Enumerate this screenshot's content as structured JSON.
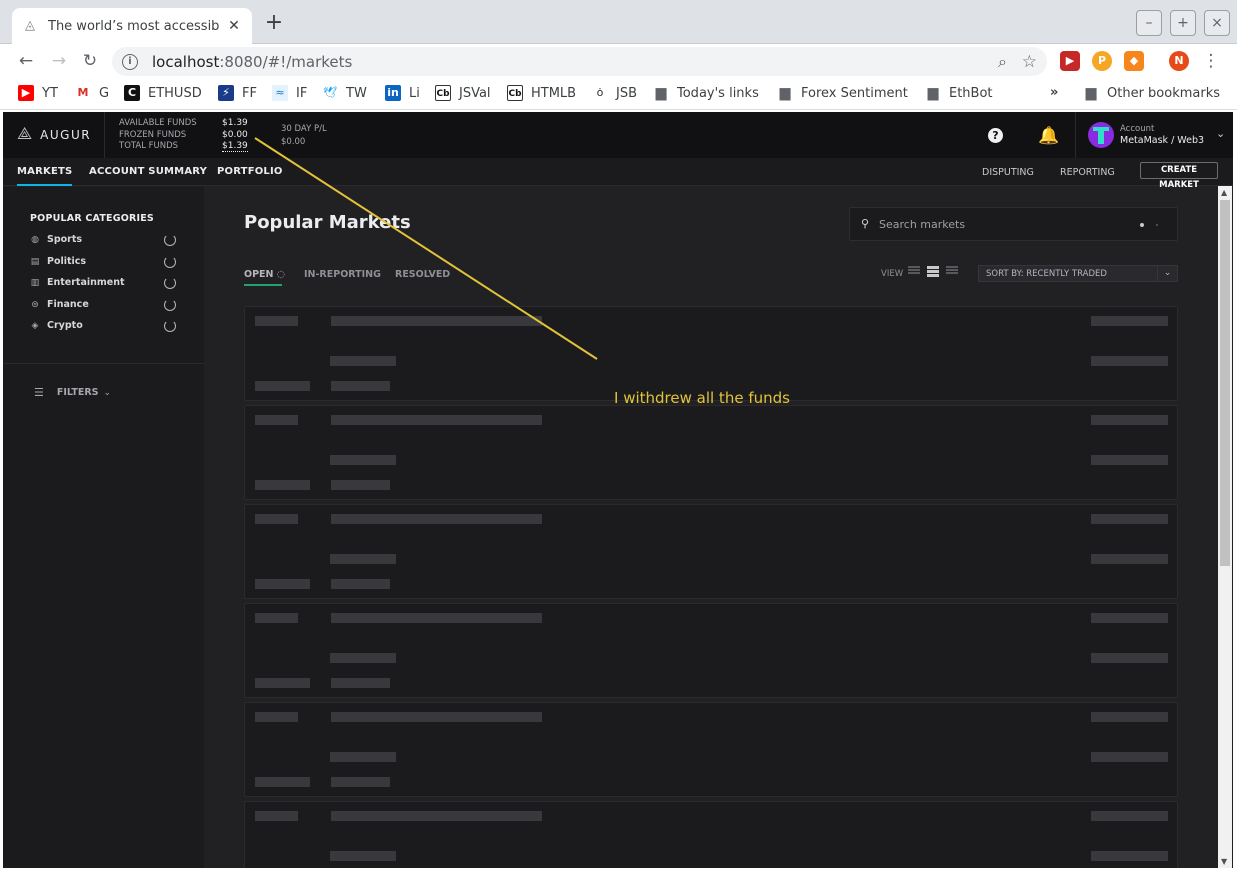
{
  "browser": {
    "tab_title": "The world’s most accessib",
    "url_host": "localhost",
    "url_rest": ":8080/#!/markets",
    "window_controls": [
      "–",
      "+",
      "×"
    ],
    "bookmarks": [
      {
        "label": "YT",
        "icon": "youtube-icon"
      },
      {
        "label": "G",
        "icon": "gmail-icon"
      },
      {
        "label": "ETHUSD",
        "icon": "coin-icon"
      },
      {
        "label": "FF",
        "icon": "ff-icon"
      },
      {
        "label": "IF",
        "icon": "if-icon"
      },
      {
        "label": "TW",
        "icon": "twitter-icon"
      },
      {
        "label": "Li",
        "icon": "linkedin-icon"
      },
      {
        "label": "JSVal",
        "icon": "cb-icon"
      },
      {
        "label": "HTMLB",
        "icon": "cb-icon"
      },
      {
        "label": "JSB",
        "icon": "owl-icon"
      },
      {
        "label": "Today's links",
        "icon": "folder-icon"
      },
      {
        "label": "Forex Sentiment",
        "icon": "folder-icon"
      },
      {
        "label": "EthBot",
        "icon": "folder-icon"
      }
    ],
    "overflow": "»",
    "other_bookmarks": "Other bookmarks",
    "profile_initial": "N"
  },
  "app": {
    "logo_text": "AUGUR",
    "funds": {
      "labels": [
        "AVAILABLE FUNDS",
        "FROZEN FUNDS",
        "TOTAL FUNDS"
      ],
      "values": [
        "$1.39",
        "$0.00",
        "$1.39"
      ]
    },
    "pl": {
      "label": "30 DAY P/L",
      "value": "$0.00"
    },
    "account": {
      "label": "Account",
      "value": "MetaMask / Web3"
    },
    "nav": {
      "left": [
        "MARKETS",
        "ACCOUNT SUMMARY",
        "PORTFOLIO"
      ],
      "right": [
        "DISPUTING",
        "REPORTING"
      ],
      "create": "CREATE MARKET"
    },
    "sidebar": {
      "title": "POPULAR CATEGORIES",
      "categories": [
        "Sports",
        "Politics",
        "Entertainment",
        "Finance",
        "Crypto"
      ],
      "filters": "FILTERS"
    },
    "main": {
      "title": "Popular Markets",
      "search_placeholder": "Search markets",
      "tabs": [
        "OPEN",
        "IN-REPORTING",
        "RESOLVED"
      ],
      "view_label": "VIEW",
      "sort": "SORT BY: RECENTLY TRADED"
    }
  },
  "annotation": "I withdrew all the funds",
  "colors": {
    "accent": "#0fb5e3",
    "open_tab": "#23a36c",
    "annotation": "#e1c33a"
  }
}
